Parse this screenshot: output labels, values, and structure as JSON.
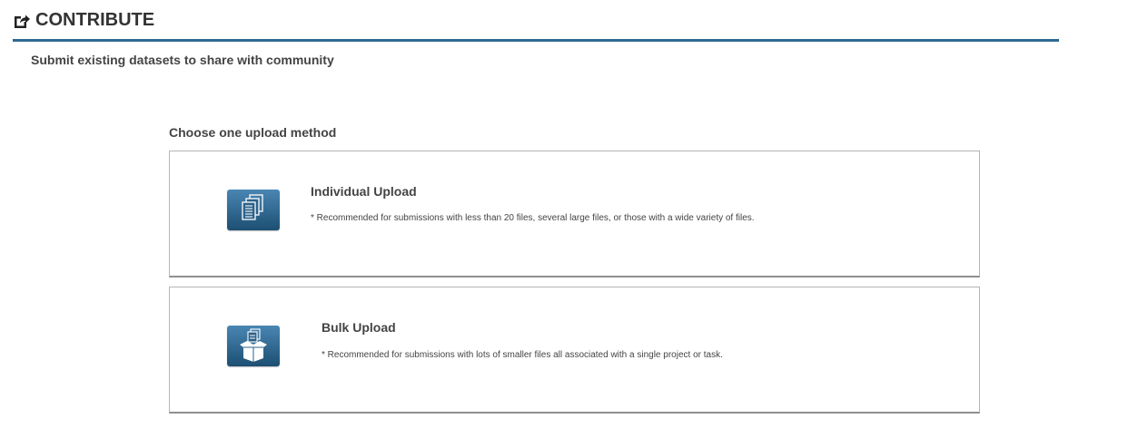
{
  "header": {
    "title": "CONTRIBUTE",
    "icon": "share-edit-icon"
  },
  "subtitle": "Submit existing datasets to share with community",
  "upload": {
    "choose_label": "Choose one upload method",
    "options": [
      {
        "icon": "documents-icon",
        "title": "Individual Upload",
        "description": "* Recommended for submissions with less than 20 files, several large files, or those with a wide variety of files."
      },
      {
        "icon": "open-box-icon",
        "title": "Bulk Upload",
        "description": "* Recommended for submissions with lots of smaller files all associated with a single project or task."
      }
    ]
  },
  "colors": {
    "accent": "#2e6a92",
    "icon_tile_top": "#4a86b3",
    "icon_tile_bottom": "#1d4f72",
    "card_border": "#b5b5b5"
  }
}
